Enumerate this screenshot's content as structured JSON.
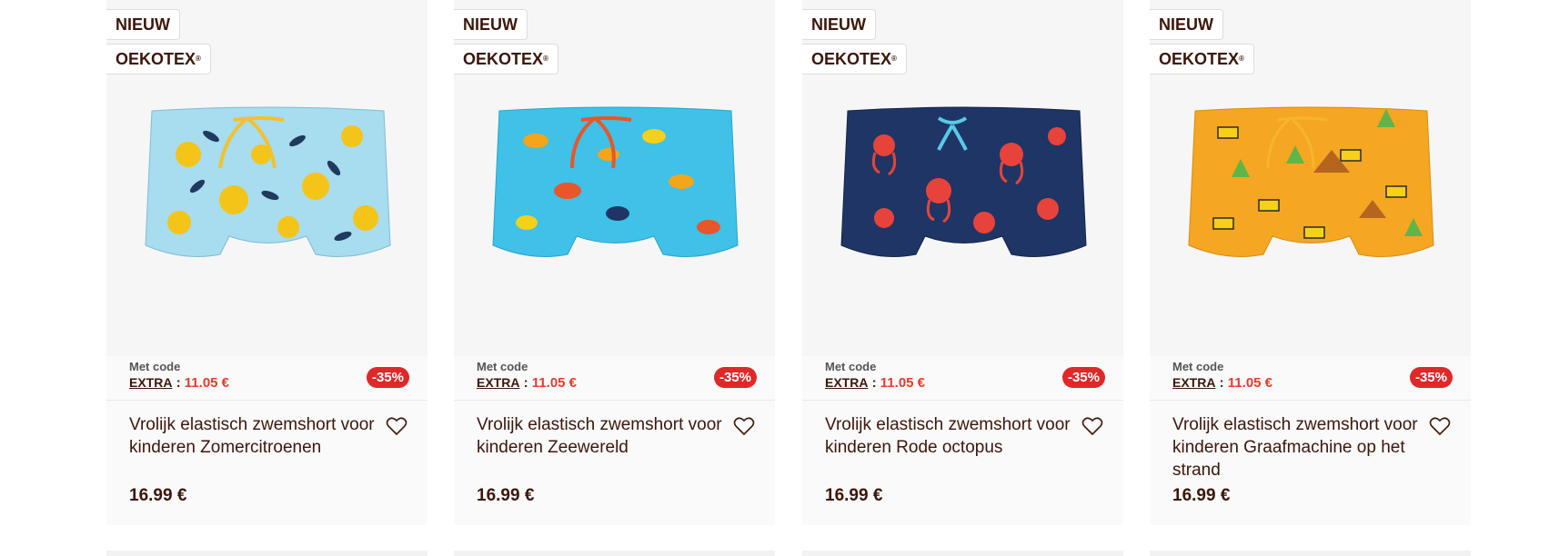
{
  "products": [
    {
      "badge_new": "NIEUW",
      "badge_oekotex": "OEKOTEX",
      "code_label": "Met code",
      "code_name": "EXTRA",
      "code_price": "11.05 €",
      "discount": "-35%",
      "title": "Vrolijk elastisch zwemshort voor kinderen Zomercitroenen",
      "price": "16.99 €",
      "colors": {
        "base": "#a8dcef",
        "accent": "#f5c419",
        "string": "#f2c22e"
      }
    },
    {
      "badge_new": "NIEUW",
      "badge_oekotex": "OEKOTEX",
      "code_label": "Met code",
      "code_name": "EXTRA",
      "code_price": "11.05 €",
      "discount": "-35%",
      "title": "Vrolijk elastisch zwemshort voor kinderen Zeewereld",
      "price": "16.99 €",
      "colors": {
        "base": "#3fc1e8",
        "accent": "#f6a419",
        "string": "#e8562a"
      }
    },
    {
      "badge_new": "NIEUW",
      "badge_oekotex": "OEKOTEX",
      "code_label": "Met code",
      "code_name": "EXTRA",
      "code_price": "11.05 €",
      "discount": "-35%",
      "title": "Vrolijk elastisch zwemshort voor kinderen Rode octopus",
      "price": "16.99 €",
      "colors": {
        "base": "#1e3566",
        "accent": "#e8433a",
        "string": "#59c9e6"
      }
    },
    {
      "badge_new": "NIEUW",
      "badge_oekotex": "OEKOTEX",
      "code_label": "Met code",
      "code_name": "EXTRA",
      "code_price": "11.05 €",
      "discount": "-35%",
      "title": "Vrolijk elastisch zwemshort voor kinderen Graafmachine op het strand",
      "price": "16.99 €",
      "colors": {
        "base": "#f5a623",
        "accent": "#2a2a2a",
        "string": "#f7b52e"
      }
    }
  ],
  "icons": {
    "favorite": "heart-outline-icon"
  }
}
